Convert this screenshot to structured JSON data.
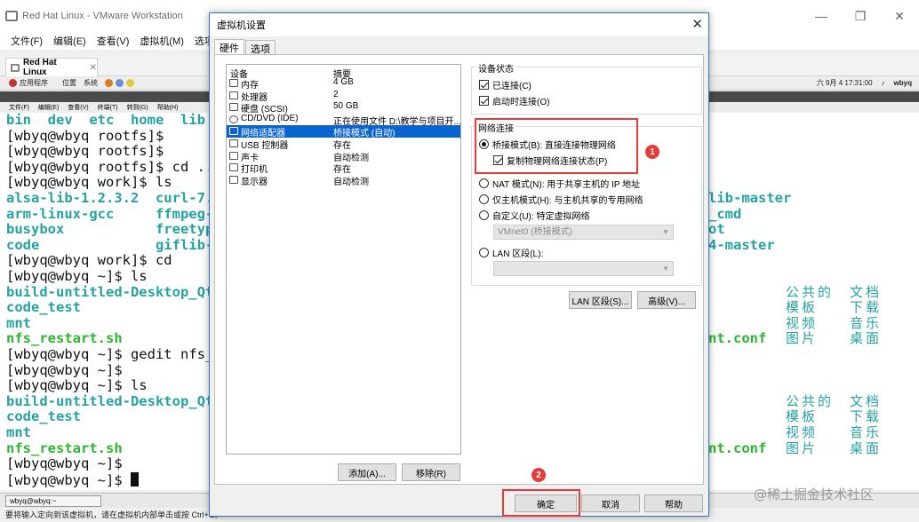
{
  "vmware": {
    "title": "Red Hat Linux - VMware Workstation",
    "menu": [
      "文件(F)",
      "编辑(E)",
      "查看(V)",
      "虚拟机(M)",
      "选项卡(T)"
    ],
    "tab_label": "Red Hat Linux",
    "status": "要将输入定向到该虚拟机，请在虚拟机内部单击或按 Ctrl+G。"
  },
  "guest_panel": {
    "left": [
      "应用程序",
      "位置",
      "系统"
    ],
    "datetime": "六 9月  4 17:31:00",
    "user": "wbyq"
  },
  "terminal": {
    "menu": [
      "文件(F)",
      "编辑(E)",
      "查看(V)",
      "终端(T)",
      "转到(G)",
      "帮助(H)"
    ],
    "lines": [
      {
        "text": "bin  dev  etc  home  lib",
        "color": "cyan"
      },
      {
        "text": "[wbyq@wbyq rootfs]$",
        "color": "black"
      },
      {
        "text": "[wbyq@wbyq rootfs]$",
        "color": "black"
      },
      {
        "text": "[wbyq@wbyq rootfs]$ cd ..",
        "color": "black"
      },
      {
        "text": "[wbyq@wbyq work]$ ls",
        "color": "black"
      },
      {
        "text": "alsa-lib-1.2.3.2  curl-7.7",
        "color": "cyan"
      },
      {
        "text": "arm-linux-gcc     ffmpeg-4",
        "color": "cyan"
      },
      {
        "text": "busybox           freetype",
        "color": "cyan"
      },
      {
        "text": "code              giflib-5",
        "color": "green-cyan"
      },
      {
        "text": "[wbyq@wbyq work]$ cd",
        "color": "black"
      },
      {
        "text": "[wbyq@wbyq ~]$ ls",
        "color": "black"
      },
      {
        "text": "build-untitled-Desktop_Qt_",
        "color": "cyan"
      },
      {
        "text": "code_test",
        "color": "cyan"
      },
      {
        "text": "mnt",
        "color": "cyan"
      },
      {
        "text": "nfs_restart.sh",
        "color": "green"
      },
      {
        "text": "[wbyq@wbyq ~]$ gedit nfs_",
        "color": "black"
      },
      {
        "text": "[wbyq@wbyq ~]$",
        "color": "black"
      },
      {
        "text": "[wbyq@wbyq ~]$ ls",
        "color": "black"
      },
      {
        "text": "build-untitled-Desktop_Qt_",
        "color": "cyan"
      },
      {
        "text": "code_test",
        "color": "cyan"
      },
      {
        "text": "mnt",
        "color": "cyan"
      },
      {
        "text": "nfs_restart.sh",
        "color": "green"
      },
      {
        "text": "[wbyq@wbyq ~]$",
        "color": "black"
      },
      {
        "text": "[wbyq@wbyq ~]$ ",
        "color": "black"
      }
    ],
    "right_fragments": {
      "lib_master": "lib-master",
      "cmd": "_cmd",
      "ot": "ot",
      "master4": "4-master",
      "nt_conf": "nt.conf"
    },
    "cjk_block": [
      "公共的",
      "文档",
      "模板",
      "下载",
      "视频",
      "音乐",
      "图片",
      "桌面"
    ],
    "taskbar_item": "wbyq@wbyq:~"
  },
  "dialog": {
    "title": "虚拟机设置",
    "tabs": [
      "硬件",
      "选项"
    ],
    "list_headers": {
      "device": "设备",
      "summary": "摘要"
    },
    "devices": [
      {
        "name": "内存",
        "summary": "4 GB",
        "icon": "memory-icon"
      },
      {
        "name": "处理器",
        "summary": "2",
        "icon": "cpu-icon"
      },
      {
        "name": "硬盘 (SCSI)",
        "summary": "50 GB",
        "icon": "disk-icon"
      },
      {
        "name": "CD/DVD (IDE)",
        "summary": "正在使用文件 D:\\教学与项目开...",
        "icon": "cd-icon"
      },
      {
        "name": "网络适配器",
        "summary": "桥接模式 (自动)",
        "icon": "network-icon"
      },
      {
        "name": "USB 控制器",
        "summary": "存在",
        "icon": "usb-icon"
      },
      {
        "name": "声卡",
        "summary": "自动检测",
        "icon": "sound-icon"
      },
      {
        "name": "打印机",
        "summary": "存在",
        "icon": "printer-icon"
      },
      {
        "name": "显示器",
        "summary": "自动检测",
        "icon": "display-icon"
      }
    ],
    "selected_index": 4,
    "add_button": "添加(A)...",
    "remove_button": "移除(R)",
    "device_status": {
      "label": "设备状态",
      "connected": "已连接(C)",
      "connect_on_start": "启动时连接(O)"
    },
    "network": {
      "label": "网络连接",
      "bridged": "桥接模式(B): 直接连接物理网络",
      "replicate": "复制物理网络连接状态(P)",
      "nat": "NAT 模式(N): 用于共享主机的 IP 地址",
      "host_only": "仅主机模式(H): 与主机共享的专用网络",
      "custom": "自定义(U): 特定虚拟网络",
      "custom_value": "VMnet0 (桥接模式)",
      "lan_segment": "LAN 区段(L):",
      "lan_value": ""
    },
    "lan_segments_button": "LAN 区段(S)...",
    "advanced_button": "高级(V)...",
    "ok_button": "确定",
    "cancel_button": "取消",
    "help_button": "帮助"
  },
  "annotations": {
    "badge1": "1",
    "badge2": "2"
  },
  "watermark": "@稀土掘金技术社区",
  "colors": {
    "accent": "#0a64d0",
    "annotation_red": "#e53b3b",
    "term_cyan": "#26a2a2",
    "term_green": "#2fb52f"
  }
}
